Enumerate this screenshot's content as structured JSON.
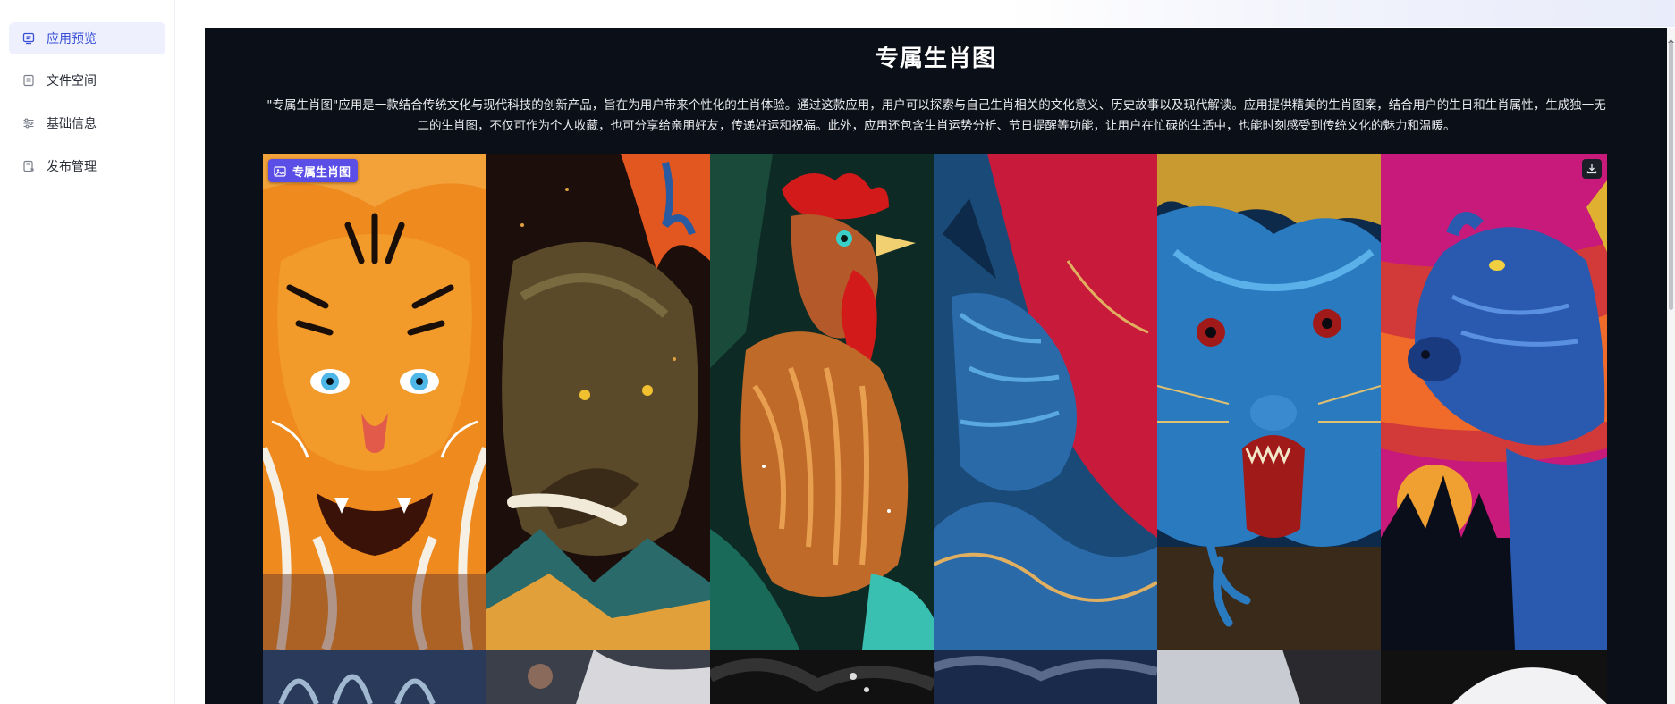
{
  "sidebar": {
    "items": [
      {
        "label": "应用预览",
        "icon": "preview-icon",
        "active": true
      },
      {
        "label": "文件空间",
        "icon": "file-space-icon",
        "active": false
      },
      {
        "label": "基础信息",
        "icon": "settings-sliders-icon",
        "active": false
      },
      {
        "label": "发布管理",
        "icon": "publish-icon",
        "active": false
      }
    ]
  },
  "main": {
    "title": "专属生肖图",
    "description": "\"专属生肖图\"应用是一款结合传统文化与现代科技的创新产品，旨在为用户带来个性化的生肖体验。通过这款应用，用户可以探索与自己生肖相关的文化意义、历史故事以及现代解读。应用提供精美的生肖图案，结合用户的生日和生肖属性，生成独一无二的生肖图，不仅可作为个人收藏，也可分享给亲朋好友，传递好运和祝福。此外，应用还包含生肖运势分析、节日提醒等功能，让用户在忙碌的生活中，也能时刻感受到传统文化的魅力和温暖。",
    "image": {
      "badge_label": "专属生肖图",
      "badge_icon": "image-icon",
      "download_icon": "download-icon",
      "panels": [
        "tiger",
        "boar",
        "rooster",
        "wolf",
        "rat",
        "ox"
      ]
    }
  },
  "colors": {
    "accent": "#3a4fd6",
    "badge": "#5b4ee6",
    "panel_bg": "#0b0f17"
  }
}
